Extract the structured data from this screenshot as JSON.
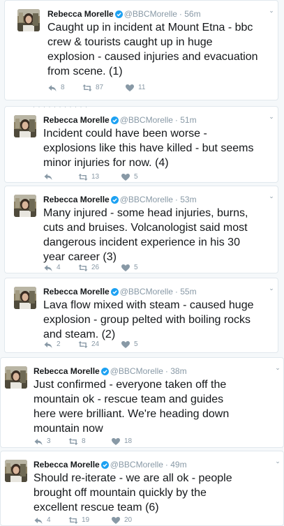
{
  "icons": {
    "reply": "reply-icon",
    "retweet": "retweet-icon",
    "like": "heart-icon",
    "verified": "verified-badge-icon",
    "more": "chevron-down-icon"
  },
  "colors": {
    "verified": "#1da1f2",
    "meta": "#8899a6",
    "text": "#14171a",
    "background": "#f5f8fa",
    "card": "#ffffff"
  },
  "tweets": [
    {
      "name": "Rebecca Morelle",
      "handle": "@BBCMorelle",
      "time": "· 56m",
      "lines": [
        "Caught up in incident at Mount Etna - bbc",
        "crew & tourists caught up in huge",
        "explosion - caused injuries and evacuation",
        "from scene. (1)"
      ],
      "replies": "8",
      "retweets": "87",
      "likes": "11"
    },
    {
      "name": "Rebecca Morelle",
      "handle": "@BBCMorelle",
      "time": "· 51m",
      "lines": [
        "Incident could have been worse -",
        "explosions like this have killed - but seems",
        "minor injuries for now. (4)"
      ],
      "replies": "",
      "retweets": "13",
      "likes": "5"
    },
    {
      "name": "Rebecca Morelle",
      "handle": "@BBCMorelle",
      "time": "· 53m",
      "lines": [
        "Many injured - some head injuries, burns,",
        "cuts and bruises. Volcanologist said most",
        "dangerous incident experience in his 30",
        "year career (3)"
      ],
      "replies": "4",
      "retweets": "26",
      "likes": "5"
    },
    {
      "name": "Rebecca Morelle",
      "handle": "@BBCMorelle",
      "time": "· 55m",
      "lines": [
        "Lava flow mixed with steam - caused huge",
        "explosion - group pelted with boiling rocks",
        "and steam. (2)"
      ],
      "replies": "2",
      "retweets": "24",
      "likes": "5"
    },
    {
      "name": "Rebecca Morelle",
      "handle": "@BBCMorelle",
      "time": "· 38m",
      "lines": [
        "Just confirmed - everyone taken off the",
        "mountain ok - rescue team and guides",
        "here were brilliant. We're heading down",
        "mountain now"
      ],
      "replies": "3",
      "retweets": "8",
      "likes": "18"
    },
    {
      "name": "Rebecca Morelle",
      "handle": "@BBCMorelle",
      "time": "· 49m",
      "lines": [
        "Should re-iterate - we are all ok - people",
        "brought off mountain quickly by the",
        "excellent rescue team (6)"
      ],
      "replies": "4",
      "retweets": "19",
      "likes": "20"
    }
  ]
}
